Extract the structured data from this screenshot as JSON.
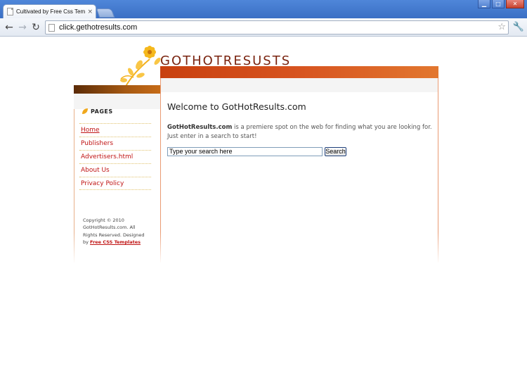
{
  "browser": {
    "tab_title": "Cultivated by Free Css Templ",
    "tab_close": "×",
    "url": "click.gethotresults.com",
    "window_controls": {
      "minimize": "▁",
      "maximize": "□",
      "close": "✕"
    },
    "icons": {
      "back": "back-arrow-icon",
      "forward": "forward-arrow-icon",
      "reload": "reload-icon",
      "star": "bookmark-star-icon",
      "wrench": "wrench-icon"
    }
  },
  "site": {
    "logo_text": "GOTHOTRESUSTS",
    "sidebar": {
      "heading": "PAGES",
      "items": [
        {
          "label": "Home",
          "current": true
        },
        {
          "label": "Publishers"
        },
        {
          "label": "Advertisers.html"
        },
        {
          "label": "About Us"
        },
        {
          "label": "Privacy Policy"
        }
      ],
      "copyright_text": "Copyright © 2010 GotHotResults.com. All Rights Reserved. Designed by ",
      "copyright_link": "Free CSS Templates"
    },
    "main": {
      "heading": "Welcome to GotHotResults.com",
      "intro_bold": "GotHotResults.com",
      "intro_rest": " is a premiere spot on the web for finding what you are looking for. Just enter in a search to start!",
      "search_value": "Type your search here",
      "search_button": "Search"
    },
    "colors": {
      "header_bar": "#d75420",
      "link": "#c01414",
      "logo_text": "#7a2410"
    }
  }
}
